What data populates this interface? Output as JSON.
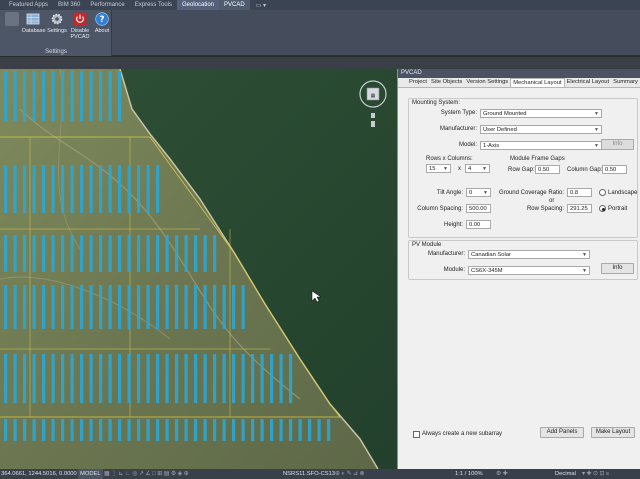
{
  "ribbon": {
    "tabs": [
      "Featured Apps",
      "BIM 360",
      "Performance",
      "Express Tools",
      "Geolocation",
      "PVCAD"
    ],
    "active_tab": "PVCAD",
    "extra": "▭ ▾",
    "buttons": [
      {
        "label": "Database"
      },
      {
        "label": "Settings"
      },
      {
        "label": "Disable PVCAD"
      },
      {
        "label": "About"
      }
    ],
    "group_caption": "Settings"
  },
  "palette": {
    "title": "PVCAD",
    "tabs": [
      "Project",
      "Site Objects",
      "Version Settings",
      "Mechanical Layout",
      "Electrical Layout",
      "Summary"
    ],
    "active_tab": "Mechanical Layout",
    "mounting": {
      "title": "Mounting System:",
      "system_type_label": "System Type:",
      "system_type_value": "Ground Mounted",
      "manufacturer_label": "Manufacturer:",
      "manufacturer_value": "User Defined",
      "model_label": "Model:",
      "model_value": "1-Axis",
      "info_label": "Info",
      "rows_cols_label": "Rows x Columns:",
      "rows_value": "15",
      "x_label": "x",
      "cols_value": "4",
      "frame_gaps_label": "Module Frame Gaps",
      "row_gap_label": "Row Gap:",
      "row_gap_value": "0.50",
      "col_gap_label": "Column Gap:",
      "col_gap_value": "0.50",
      "tilt_label": "Tilt Angle:",
      "tilt_value": "0",
      "gcr_label": "Ground Coverage Ratio:",
      "gcr_value": "0.8",
      "or_label": "or",
      "col_spacing_label": "Column Spacing:",
      "col_spacing_value": "500.00",
      "row_spacing_label": "Row Spacing:",
      "row_spacing_value": "291.25",
      "height_label": "Height:",
      "height_value": "0.00",
      "landscape_label": "Landscape",
      "portrait_label": "Portrait",
      "orientation": "Portrait"
    },
    "pv_module": {
      "title": "PV Module",
      "manufacturer_label": "Manufacturer:",
      "manufacturer_value": "Canadian Solar",
      "module_label": "Module:",
      "module_value": "CS6X-345M",
      "info_label": "Info"
    },
    "always_create_label": "Always create a new subarray",
    "add_panels_label": "Add Panels",
    "make_layout_label": "Make Layout"
  },
  "status": {
    "coords": "364.0661, 1244.5016, 0.0000",
    "model": "MODEL",
    "coord_system": "NSRS11.SFO-CS13",
    "scale": "1:1 / 100%",
    "units": "Decimal"
  },
  "colors": {
    "panel_blue": "#2aa7d6",
    "water": "#2c4a33",
    "land": "#6e7a52",
    "boundary": "#d8c94a"
  }
}
